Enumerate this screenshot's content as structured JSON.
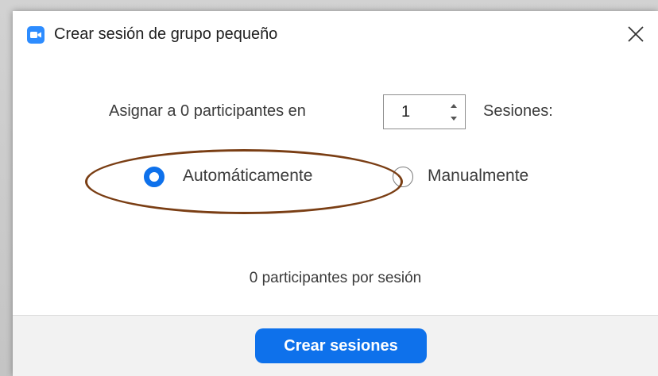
{
  "window": {
    "title": "Crear sesión de grupo pequeño",
    "app_icon": "zoom-camera-icon",
    "close_icon": "close-icon"
  },
  "assign": {
    "prefix": "Asignar a 0 participantes en",
    "sessions_count": "1",
    "suffix": "Sesiones:"
  },
  "mode": {
    "options": [
      {
        "label": "Automáticamente",
        "selected": true
      },
      {
        "label": "Manualmente",
        "selected": false
      }
    ]
  },
  "summary": {
    "per_session": "0 participantes por sesión"
  },
  "footer": {
    "create_label": "Crear sesiones"
  },
  "colors": {
    "accent": "#0e71eb",
    "annotation": "#7a3e14"
  }
}
